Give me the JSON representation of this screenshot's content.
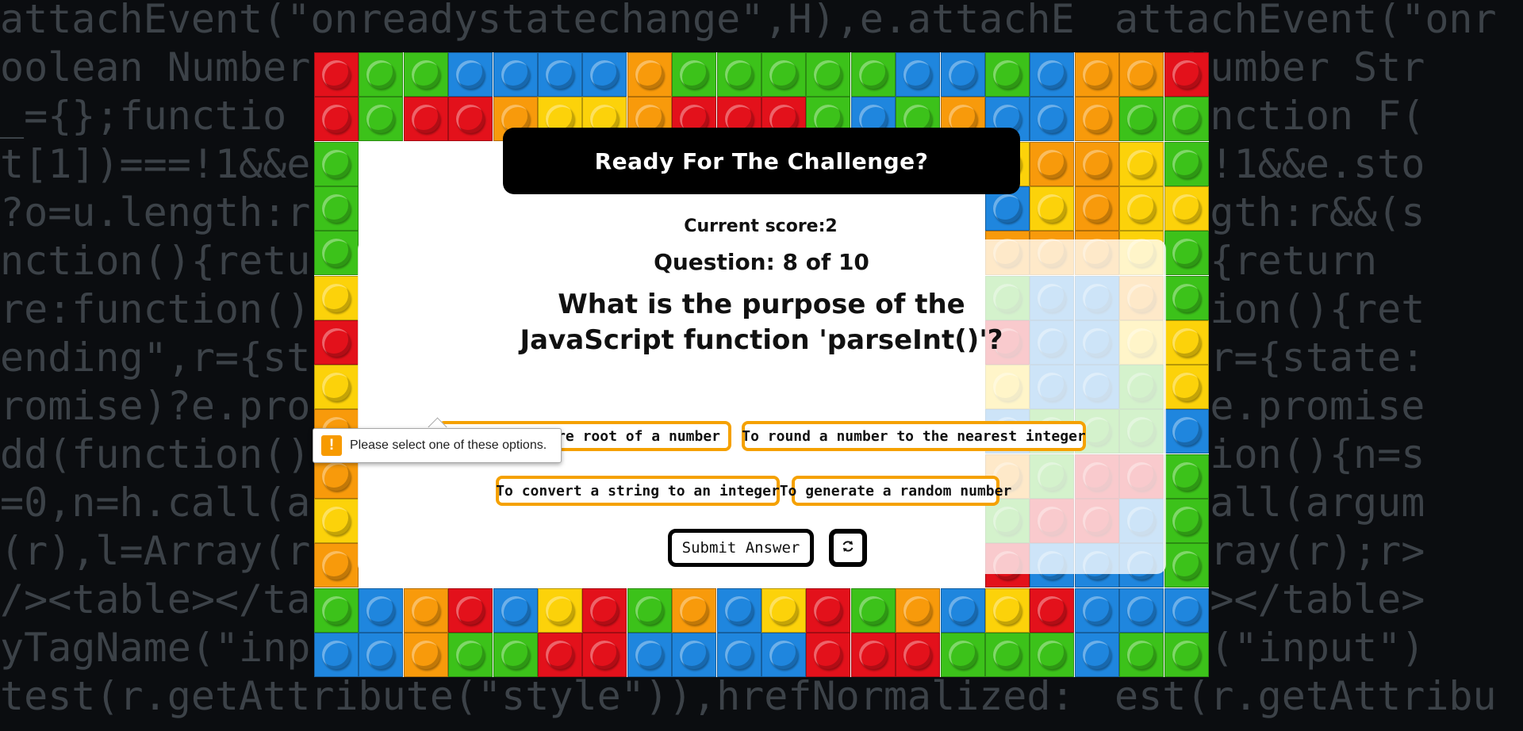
{
  "background_code": {
    "left_lines": [
      "attachEvent(\"onreadystatechange\",H),e.attachE",
      "oolean Number",
      "_={};functio",
      "t[1])===!1&&e",
      "?o=u.length:r",
      "nction(){retu",
      "re:function()",
      "ending\",r={st",
      "romise)?e.pro",
      "dd(function()",
      "=0,n=h.call(a",
      "(r),l=Array(r",
      "/><table></ta",
      "yTagName(\"inp",
      "test(r.getAttribute(\"style\")),hrefNormalized:"
    ],
    "right_lines": [
      "attachEvent(\"onr",
      "an Number Str",
      "};function F(",
      ")===!1&&e.sto",
      ".length:r&&(s",
      "on(){return ",
      "unction(){ret",
      "ng\",r={state:",
      "se)?e.promise",
      "unction(){n=s",
      "=h.call(argum",
      "l=Array(r);r>",
      "able></table>",
      "Name(\"input\")",
      "est(r.getAttribu"
    ]
  },
  "header": {
    "title": "Ready For The Challenge?"
  },
  "score": {
    "text": "Current score:2"
  },
  "question": {
    "counter": "Question: 8 of 10",
    "text": "What is the purpose of the JavaScript function 'parseInt()'?"
  },
  "options": [
    "To find the square root of a number",
    "To round a number to the nearest integer",
    "To convert a string to an integer",
    "To generate a random number"
  ],
  "options_visible": [
    "are root of a number"
  ],
  "buttons": {
    "submit": "Submit Answer",
    "refresh_icon": "refresh-icon"
  },
  "validation": {
    "icon": "warning-icon",
    "message": "Please select one of these options."
  },
  "colors": {
    "accent": "#f5a100",
    "header_bg": "#000000",
    "tooltip_icon": "#f79a00"
  }
}
